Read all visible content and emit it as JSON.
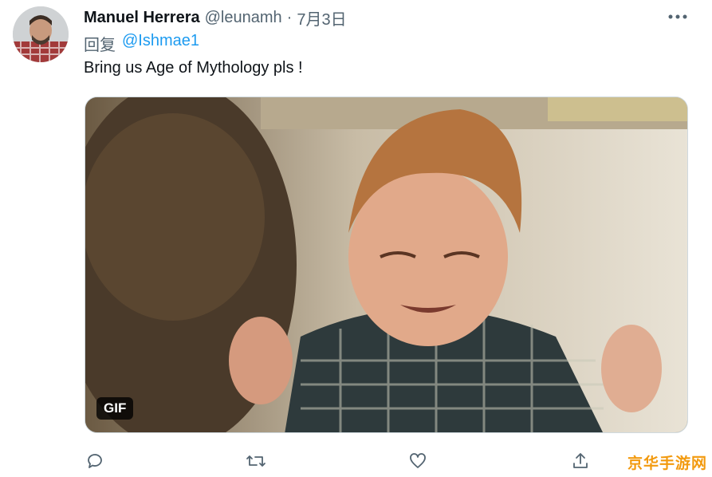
{
  "tweet": {
    "author_name": "Manuel Herrera",
    "author_handle": "@leunamh",
    "separator": "·",
    "date": "7月3日",
    "reply_label": "回复",
    "reply_mention": "@Ishmae1",
    "text": "Bring us Age of Mythology pls !",
    "media_badge": "GIF"
  },
  "actions": [
    {
      "name": "reply",
      "icon": "comment-icon"
    },
    {
      "name": "retweet",
      "icon": "retweet-icon"
    },
    {
      "name": "like",
      "icon": "heart-icon"
    },
    {
      "name": "share",
      "icon": "share-icon"
    }
  ],
  "watermark": "京华手游网",
  "colors": {
    "link": "#1d9bf0",
    "secondary": "#536471",
    "watermark": "#f29a0f"
  }
}
